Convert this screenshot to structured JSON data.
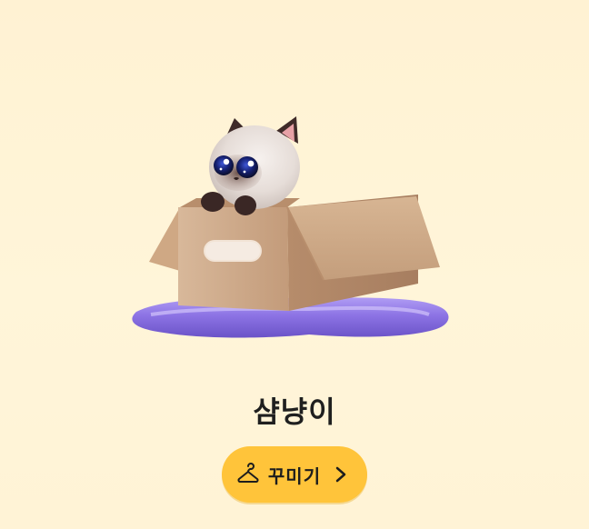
{
  "pet": {
    "name": "샴냥이"
  },
  "actions": {
    "decorate_label": "꾸미기"
  },
  "icons": {
    "decorate": "hanger-icon",
    "chevron": "chevron-right-icon"
  },
  "colors": {
    "background": "#fff3d6",
    "button": "#ffc43a",
    "text": "#1f1f1f",
    "cushion": "#8a70e0",
    "box": "#c8a07f"
  }
}
